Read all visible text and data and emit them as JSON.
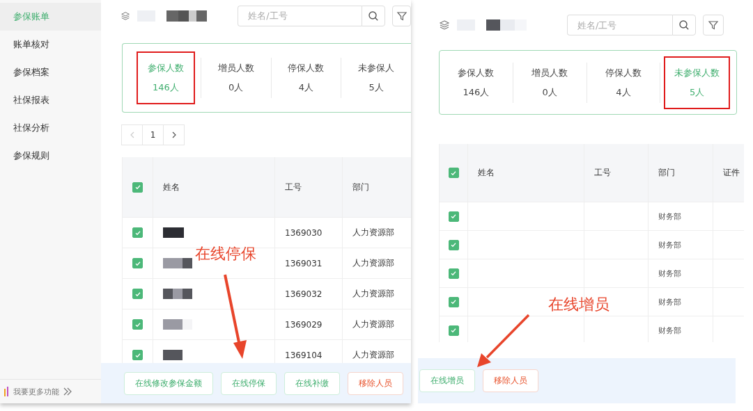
{
  "left_panel": {
    "sidebar": {
      "items": [
        {
          "label": "参保账单",
          "selected": true
        },
        {
          "label": "账单核对",
          "selected": false
        },
        {
          "label": "参保档案",
          "selected": false
        },
        {
          "label": "社保报表",
          "selected": false
        },
        {
          "label": "社保分析",
          "selected": false
        },
        {
          "label": "参保规则",
          "selected": false
        }
      ],
      "footer_link": "我要更多功能"
    },
    "search": {
      "placeholder": "姓名/工号"
    },
    "stats": [
      {
        "label": "参保人数",
        "value": "146人",
        "selected": true,
        "highlighted": true
      },
      {
        "label": "增员人数",
        "value": "0人",
        "selected": false,
        "highlighted": false
      },
      {
        "label": "停保人数",
        "value": "4人",
        "selected": false,
        "highlighted": false
      },
      {
        "label": "未参保人",
        "value": "5人",
        "selected": false,
        "highlighted": false
      }
    ],
    "pagination": {
      "page": "1"
    },
    "table": {
      "header_checked": true,
      "columns": [
        "姓名",
        "工号",
        "部门"
      ],
      "rows": [
        {
          "checked": true,
          "id": "1369030",
          "dept": "人力资源部"
        },
        {
          "checked": true,
          "id": "1369031",
          "dept": "人力资源部"
        },
        {
          "checked": true,
          "id": "1369032",
          "dept": "人力资源部"
        },
        {
          "checked": true,
          "id": "1369029",
          "dept": "人力资源部"
        },
        {
          "checked": true,
          "id": "1369104",
          "dept": "人力资源部"
        }
      ]
    },
    "actions": [
      {
        "label": "在线修改参保金额",
        "kind": "primary"
      },
      {
        "label": "在线停保",
        "kind": "primary"
      },
      {
        "label": "在线补缴",
        "kind": "primary"
      },
      {
        "label": "移除人员",
        "kind": "danger"
      }
    ],
    "annotation": "在线停保"
  },
  "right_panel": {
    "search": {
      "placeholder": "姓名/工号"
    },
    "stats": [
      {
        "label": "参保人数",
        "value": "146人",
        "selected": false,
        "highlighted": false
      },
      {
        "label": "增员人数",
        "value": "0人",
        "selected": false,
        "highlighted": false
      },
      {
        "label": "停保人数",
        "value": "4人",
        "selected": false,
        "highlighted": false
      },
      {
        "label": "未参保人数",
        "value": "5人",
        "selected": true,
        "highlighted": true
      }
    ],
    "table": {
      "header_checked": true,
      "columns": [
        "姓名",
        "工号",
        "部门",
        "证件"
      ],
      "rows": [
        {
          "checked": true,
          "dept": "财务部"
        },
        {
          "checked": true,
          "dept": "财务部"
        },
        {
          "checked": true,
          "dept": "财务部"
        },
        {
          "checked": true,
          "dept": "财务部"
        },
        {
          "checked": true,
          "dept": "财务部"
        }
      ]
    },
    "actions": [
      {
        "label": "在线增员",
        "kind": "primary"
      },
      {
        "label": "移除人员",
        "kind": "danger"
      }
    ],
    "annotation": "在线增员"
  }
}
